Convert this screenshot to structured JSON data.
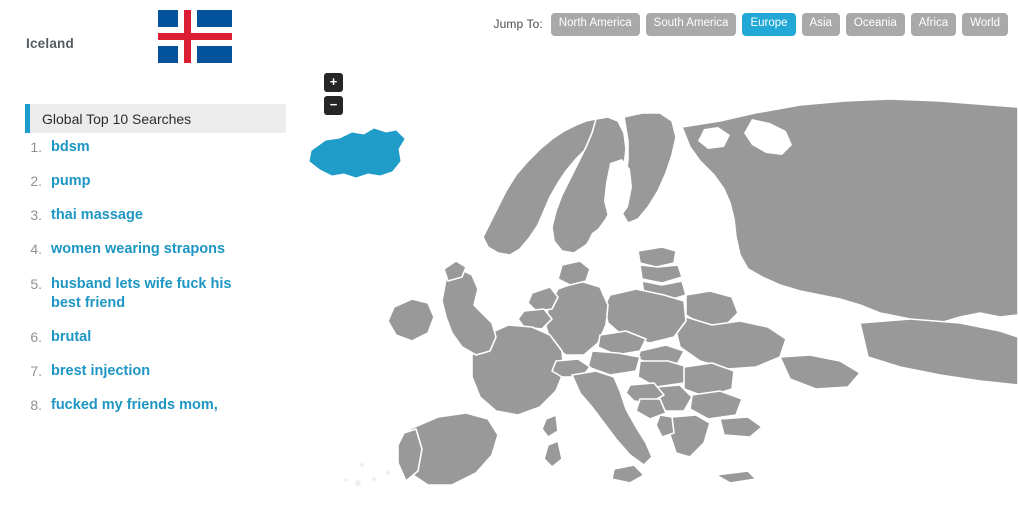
{
  "header": {
    "jump_label": "Jump To:",
    "regions": [
      {
        "label": "North America",
        "active": false
      },
      {
        "label": "South America",
        "active": false
      },
      {
        "label": "Europe",
        "active": true
      },
      {
        "label": "Asia",
        "active": false
      },
      {
        "label": "Oceania",
        "active": false
      },
      {
        "label": "Africa",
        "active": false
      },
      {
        "label": "World",
        "active": false
      }
    ]
  },
  "country": {
    "name": "Iceland",
    "flag_name": "iceland-flag",
    "highlight_color": "#1f9dc8"
  },
  "panel": {
    "title": "Global Top 10 Searches",
    "accent_color": "#1a9ccd",
    "items": [
      {
        "num": "1.",
        "text": "bdsm"
      },
      {
        "num": "2.",
        "text": "pump"
      },
      {
        "num": "3.",
        "text": "thai massage"
      },
      {
        "num": "4.",
        "text": "women wearing strapons"
      },
      {
        "num": "5.",
        "text": "husband lets wife fuck his best friend"
      },
      {
        "num": "6.",
        "text": "brutal"
      },
      {
        "num": "7.",
        "text": "brest injection"
      },
      {
        "num": "8.",
        "text": "fucked my friends mom,"
      }
    ]
  },
  "map": {
    "zoom_in_label": "+",
    "zoom_out_label": "−",
    "land_color": "#999999",
    "border_color": "#ffffff",
    "ocean_color": "#ffffff",
    "selected_region": "Europe"
  }
}
